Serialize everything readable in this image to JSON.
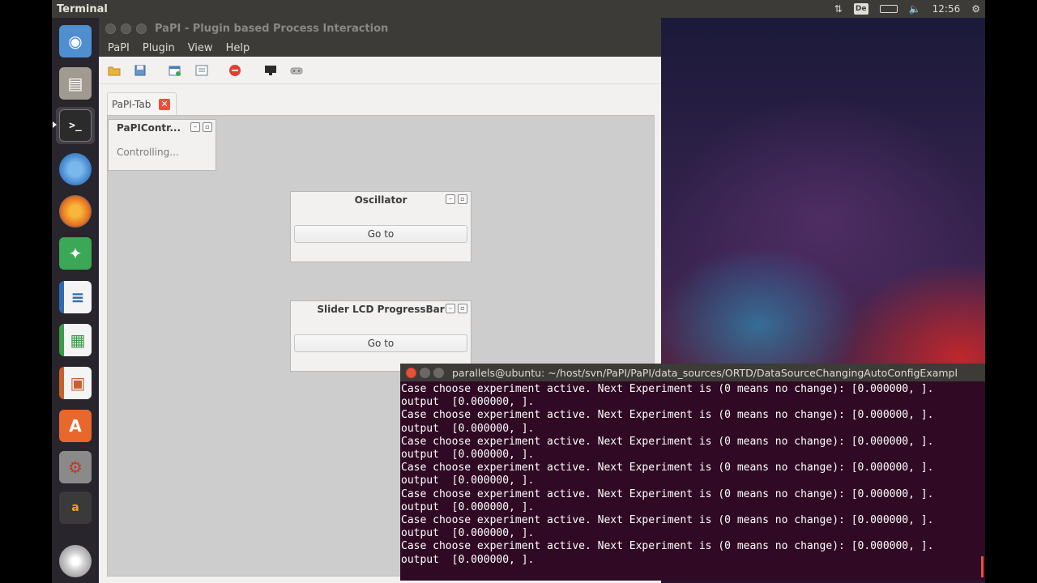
{
  "top_panel": {
    "app_title": "Terminal",
    "keyboard_layout": "De",
    "clock": "12:56"
  },
  "launcher": {
    "items": [
      {
        "name": "dash-home",
        "color": "#4f8fd0"
      },
      {
        "name": "files",
        "color": "#a09a90"
      },
      {
        "name": "terminal",
        "color": "#2b2b2b"
      },
      {
        "name": "chromium",
        "color": "#4a8fd4"
      },
      {
        "name": "firefox",
        "color": "#e8731f"
      },
      {
        "name": "system-monitor",
        "color": "#3aa856"
      },
      {
        "name": "libreoffice-writer",
        "color": "#2d6ab4"
      },
      {
        "name": "libreoffice-calc",
        "color": "#3a9a46"
      },
      {
        "name": "libreoffice-impress",
        "color": "#c8602a"
      },
      {
        "name": "software-center",
        "color": "#e8672c"
      },
      {
        "name": "system-settings",
        "color": "#c0392b"
      },
      {
        "name": "amazon",
        "color": "#3a3a3a"
      },
      {
        "name": "disk",
        "color": "#9a9a9a"
      }
    ]
  },
  "papi": {
    "window_title": "PaPI - Plugin based Process Interaction",
    "menu": [
      "PaPI",
      "Plugin",
      "View",
      "Help"
    ],
    "tab_label": "PaPI-Tab",
    "docks": {
      "controller": {
        "title": "PaPIContr...",
        "body": "Controlling..."
      },
      "oscillator": {
        "title": "Oscillator",
        "button": "Go to"
      },
      "slider": {
        "title": "Slider LCD ProgressBar",
        "button": "Go to"
      }
    }
  },
  "terminal": {
    "title": "parallels@ubuntu: ~/host/svn/PaPI/PaPI/data_sources/ORTD/DataSourceChangingAutoConfigExampl",
    "lines": [
      "Case choose experiment active. Next Experiment is (0 means no change): [0.000000, ].",
      "output  [0.000000, ].",
      "Case choose experiment active. Next Experiment is (0 means no change): [0.000000, ].",
      "output  [0.000000, ].",
      "Case choose experiment active. Next Experiment is (0 means no change): [0.000000, ].",
      "output  [0.000000, ].",
      "Case choose experiment active. Next Experiment is (0 means no change): [0.000000, ].",
      "output  [0.000000, ].",
      "Case choose experiment active. Next Experiment is (0 means no change): [0.000000, ].",
      "output  [0.000000, ].",
      "Case choose experiment active. Next Experiment is (0 means no change): [0.000000, ].",
      "output  [0.000000, ].",
      "Case choose experiment active. Next Experiment is (0 means no change): [0.000000, ].",
      "output  [0.000000, ]."
    ]
  }
}
